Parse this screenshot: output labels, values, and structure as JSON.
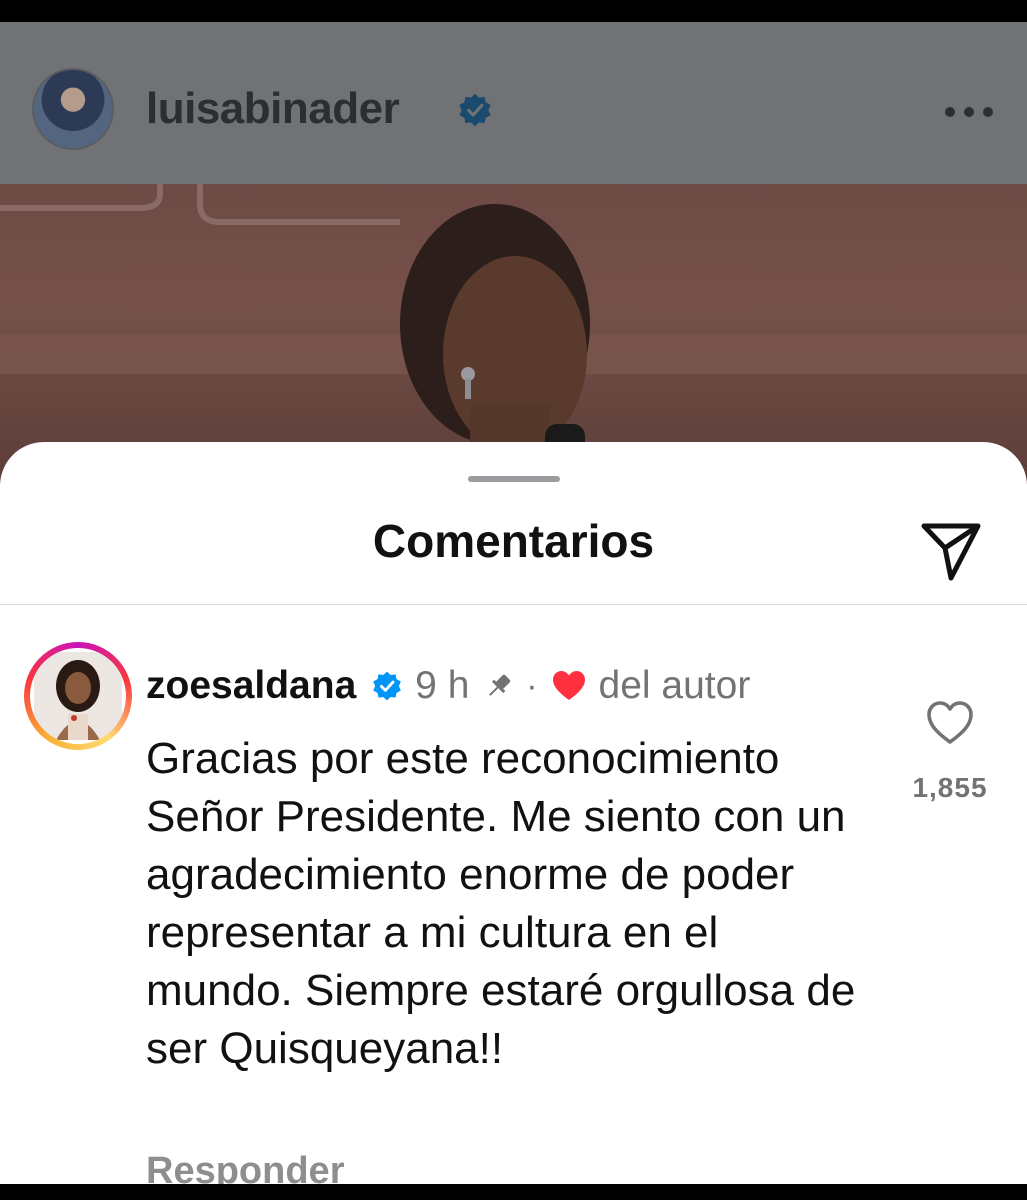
{
  "post": {
    "username": "luisabinader"
  },
  "comments_sheet": {
    "title": "Comentarios"
  },
  "comment": {
    "username": "zoesaldana",
    "time": "9 h",
    "separator": "·",
    "author_label": "del autor",
    "text": "Gracias por este reconocimiento Señor Presidente. Me siento con un agradecimiento enorme de poder representar a mi cultura en el mundo. Siempre estaré orgullosa de ser Quisqueyana!!",
    "like_count": "1,855",
    "reply_label": "Responder"
  },
  "colors": {
    "verified": "#0095f6",
    "heart": "#ff3040",
    "secondary_text": "#737373"
  },
  "icons": [
    "more-icon",
    "verified-icon",
    "share-icon",
    "pin-icon",
    "heart-icon",
    "like-icon"
  ]
}
